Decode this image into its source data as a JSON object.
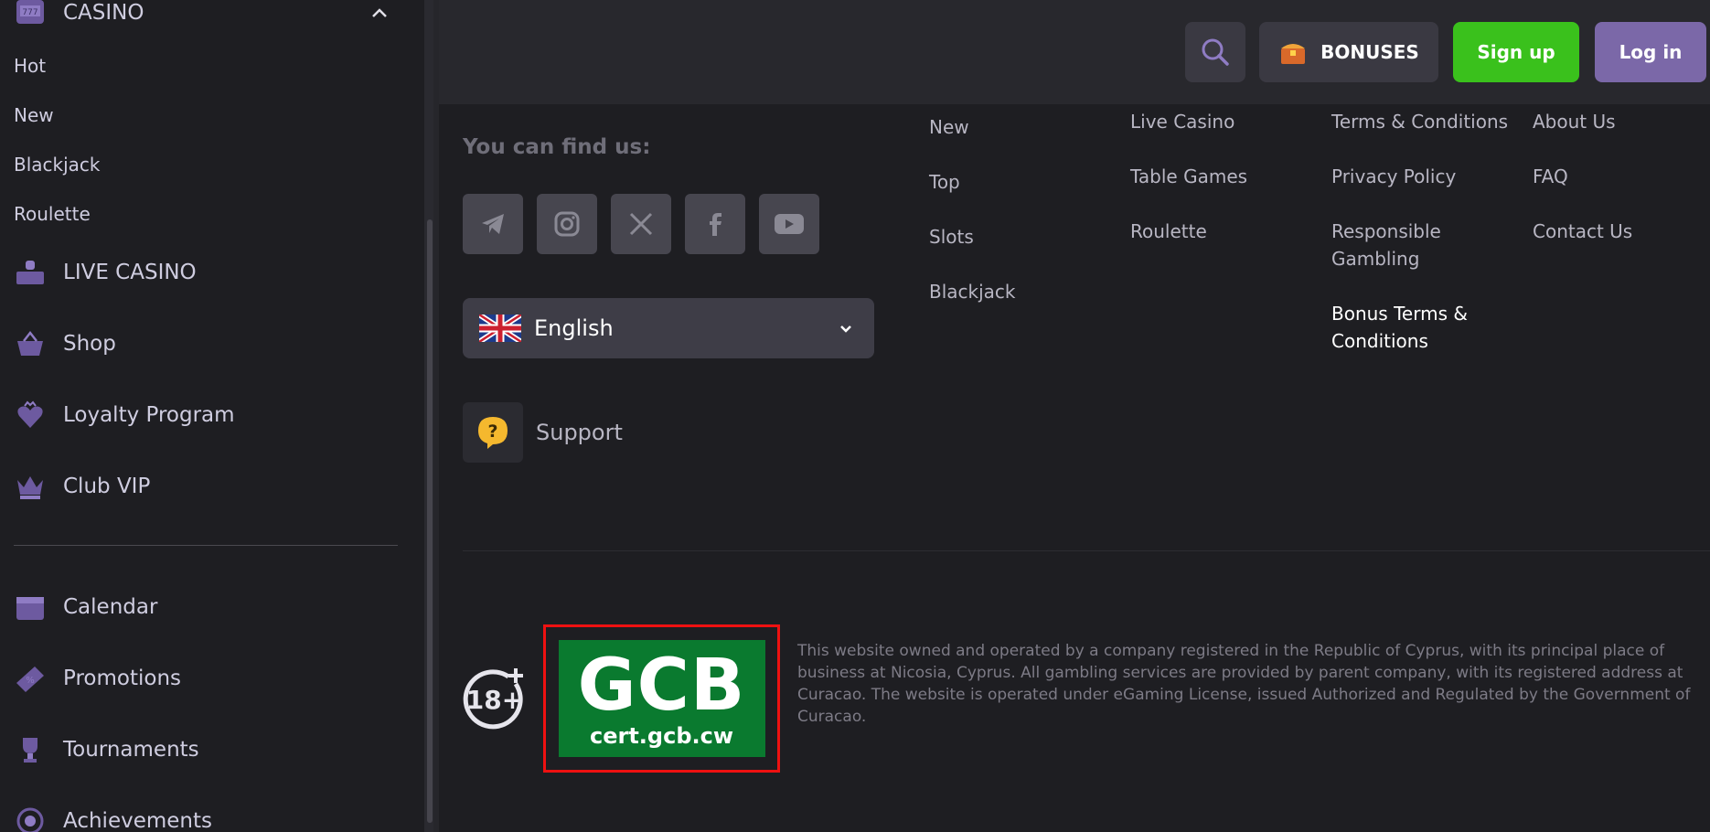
{
  "sidebar": {
    "casino_label": "CASINO",
    "sub_items": [
      "Hot",
      "New",
      "Blackjack",
      "Roulette"
    ],
    "items": [
      {
        "label": "LIVE CASINO",
        "icon": "live-casino-icon"
      },
      {
        "label": "Shop",
        "icon": "basket-icon"
      },
      {
        "label": "Loyalty Program",
        "icon": "heart-crown-icon"
      },
      {
        "label": "Club VIP",
        "icon": "crown-icon"
      },
      {
        "label": "Calendar",
        "icon": "calendar-icon"
      },
      {
        "label": "Promotions",
        "icon": "ticket-icon"
      },
      {
        "label": "Tournaments",
        "icon": "trophy-icon"
      },
      {
        "label": "Achievements",
        "icon": "target-icon"
      }
    ]
  },
  "header": {
    "bonuses_label": "BONUSES",
    "signup_label": "Sign up",
    "login_label": "Log in"
  },
  "footer": {
    "find_us": "You can find us:",
    "socials": [
      "telegram",
      "instagram",
      "x",
      "facebook",
      "youtube"
    ],
    "language": "English",
    "support_label": "Support",
    "col1": [
      "New",
      "Top",
      "Slots",
      "Blackjack"
    ],
    "col2": [
      "Live Casino",
      "Table Games",
      "Roulette"
    ],
    "col3": [
      "Terms & Conditions",
      "Privacy Policy",
      "Responsible Gambling",
      "Bonus Terms & Conditions"
    ],
    "col4": [
      "About Us",
      "FAQ",
      "Contact Us"
    ],
    "age_label": "18+",
    "gcb_big": "GCB",
    "gcb_small": "cert.gcb.cw",
    "legal_text": "This website owned and operated by a company registered in the Republic of Cyprus, with its principal place of business at Nicosia, Cyprus. All gambling services are provided by parent company, with its registered address at Curacao. The website is operated under eGaming License, issued Authorized and Regulated by the Government of Curacao."
  },
  "colors": {
    "accent_purple": "#7b68a8",
    "signup_green": "#3ac11c",
    "gcb_green": "#0a7a2f",
    "highlight_red": "#e11111",
    "support_yellow": "#f5b82e"
  }
}
